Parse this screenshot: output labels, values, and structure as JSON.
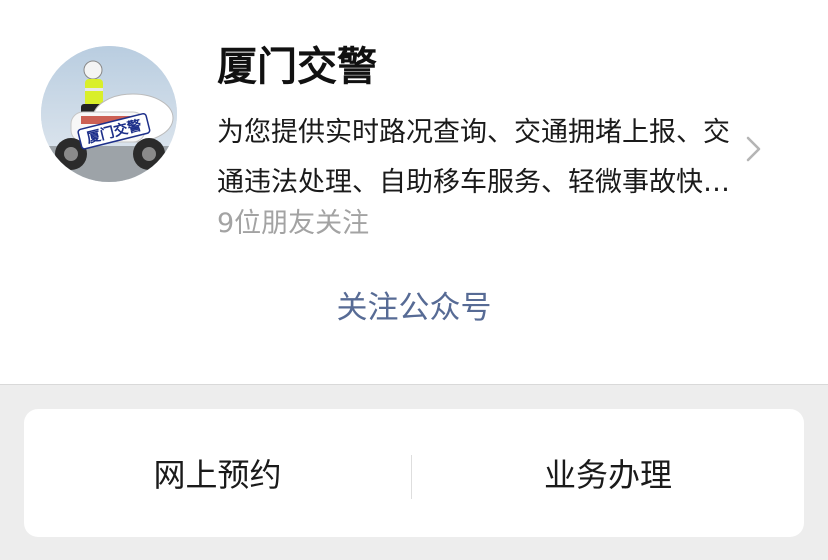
{
  "account": {
    "name": "厦门交警",
    "description": "为您提供实时路况查询、交通拥堵上报、交通违法处理、自助移车服务、轻微事故快处快赔等服务",
    "friends_following": "9位朋友关注",
    "follow_button": "关注公众号",
    "avatar_text": "厦门交警"
  },
  "menu": {
    "items": [
      {
        "label": "网上预约"
      },
      {
        "label": "业务办理"
      }
    ]
  },
  "colors": {
    "link": "#576b95",
    "secondary_text": "#a3a3a3",
    "page_background": "#ededed"
  },
  "icons": {
    "chevron": "chevron-right-icon"
  }
}
